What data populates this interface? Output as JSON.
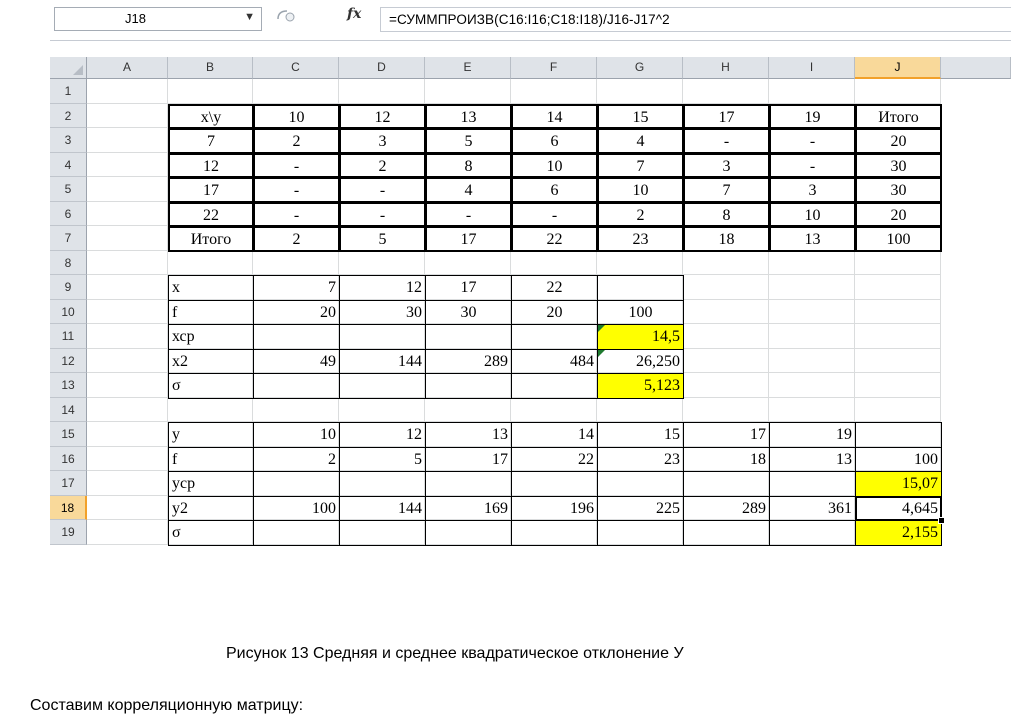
{
  "name_box": {
    "value": "J18"
  },
  "formula_bar": {
    "fx_label": "fx",
    "formula": "=СУММПРОИЗВ(C16:I16;C18:I18)/J16-J17^2"
  },
  "columns": [
    "A",
    "B",
    "C",
    "D",
    "E",
    "F",
    "G",
    "H",
    "I",
    "J"
  ],
  "selected_column": "J",
  "selected_row": "18",
  "rows": [
    "1",
    "2",
    "3",
    "4",
    "5",
    "6",
    "7",
    "8",
    "9",
    "10",
    "11",
    "12",
    "13",
    "14",
    "15",
    "16",
    "17",
    "18",
    "19"
  ],
  "corr_table": {
    "header": [
      "x\\y",
      "10",
      "12",
      "13",
      "14",
      "15",
      "17",
      "19",
      "Итого"
    ],
    "body": [
      [
        "7",
        "2",
        "3",
        "5",
        "6",
        "4",
        "-",
        "-",
        "20"
      ],
      [
        "12",
        "-",
        "2",
        "8",
        "10",
        "7",
        "3",
        "-",
        "30"
      ],
      [
        "17",
        "-",
        "-",
        "4",
        "6",
        "10",
        "7",
        "3",
        "30"
      ],
      [
        "22",
        "-",
        "-",
        "-",
        "-",
        "2",
        "8",
        "10",
        "20"
      ],
      [
        "Итого",
        "2",
        "5",
        "17",
        "22",
        "23",
        "18",
        "13",
        "100"
      ]
    ]
  },
  "x_table": {
    "rows": [
      [
        "x",
        "7",
        "12",
        "17",
        "22",
        ""
      ],
      [
        "f",
        "20",
        "30",
        "30",
        "20",
        "100"
      ],
      [
        "хср",
        "",
        "",
        "",
        "",
        "14,5"
      ],
      [
        "x2",
        "49",
        "144",
        "289",
        "484",
        "26,250"
      ],
      [
        "σ",
        "",
        "",
        "",
        "",
        "5,123"
      ]
    ]
  },
  "y_table": {
    "rows": [
      [
        "y",
        "10",
        "12",
        "13",
        "14",
        "15",
        "17",
        "19",
        ""
      ],
      [
        "f",
        "2",
        "5",
        "17",
        "22",
        "23",
        "18",
        "13",
        "100"
      ],
      [
        "уср",
        "",
        "",
        "",
        "",
        "",
        "",
        "",
        "15,07"
      ],
      [
        "y2",
        "100",
        "144",
        "169",
        "196",
        "225",
        "289",
        "361",
        "4,645"
      ],
      [
        "σ",
        "",
        "",
        "",
        "",
        "",
        "",
        "",
        "2,155"
      ]
    ]
  },
  "caption": "Рисунок 13 Средняя и среднее квадратическое отклонение У",
  "paragraph": "Составим корреляционную матрицу:",
  "colors": {
    "highlight": "#ffff00",
    "selection_header": "#f9d99a",
    "header_bg": "#dfe3e8"
  }
}
